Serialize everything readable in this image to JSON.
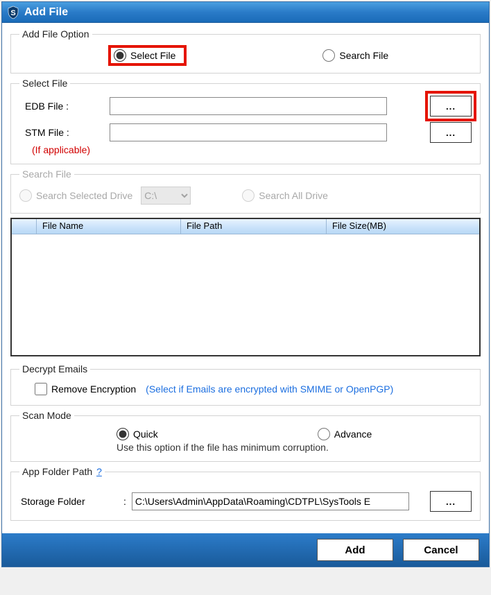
{
  "window": {
    "title": "Add File"
  },
  "option": {
    "legend": "Add File Option",
    "select_file": "Select File",
    "search_file": "Search File"
  },
  "select": {
    "legend": "Select File",
    "edb_label": "EDB File :",
    "edb_value": "",
    "edb_browse": "...",
    "stm_label": "STM File :",
    "stm_note": "(If applicable)",
    "stm_value": "",
    "stm_browse": "..."
  },
  "search": {
    "legend": "Search File",
    "selected_drive": "Search Selected Drive",
    "drive": "C:\\",
    "all_drive": "Search All Drive"
  },
  "table": {
    "col_name": "File Name",
    "col_path": "File Path",
    "col_size": "File Size(MB)"
  },
  "decrypt": {
    "legend": "Decrypt Emails",
    "checkbox": "Remove Encryption",
    "hint": "(Select if Emails are encrypted with SMIME or OpenPGP)"
  },
  "scan": {
    "legend": "Scan Mode",
    "quick": "Quick",
    "advance": "Advance",
    "note": "Use this option if the file has minimum corruption."
  },
  "appfolder": {
    "legend": "App Folder Path",
    "q": "?",
    "storage_label": "Storage Folder",
    "colon": ":",
    "storage_value": "C:\\Users\\Admin\\AppData\\Roaming\\CDTPL\\SysTools E",
    "browse": "..."
  },
  "footer": {
    "add": "Add",
    "cancel": "Cancel"
  }
}
